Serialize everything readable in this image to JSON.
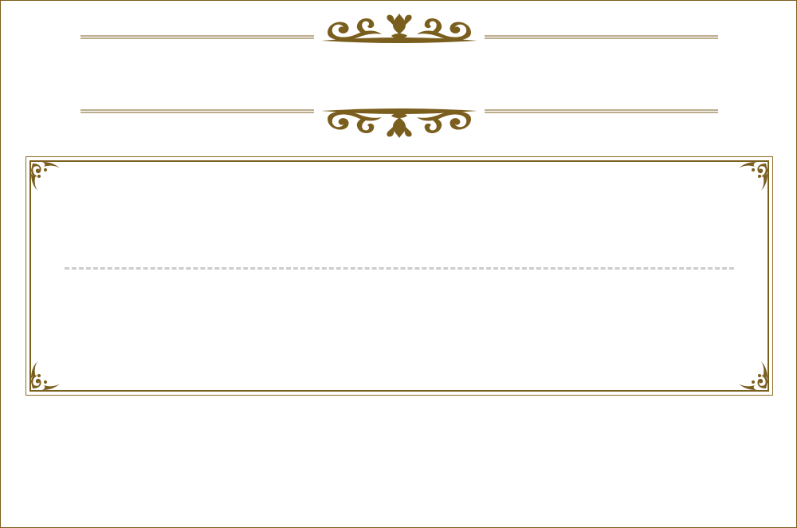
{
  "theme": {
    "ornament_color": "#7a5e1e",
    "rule_color": "#cccccc",
    "background": "#ffffff"
  },
  "icons": {
    "ornament": "flourish-ornament-icon",
    "corner": "corner-flourish-icon"
  }
}
